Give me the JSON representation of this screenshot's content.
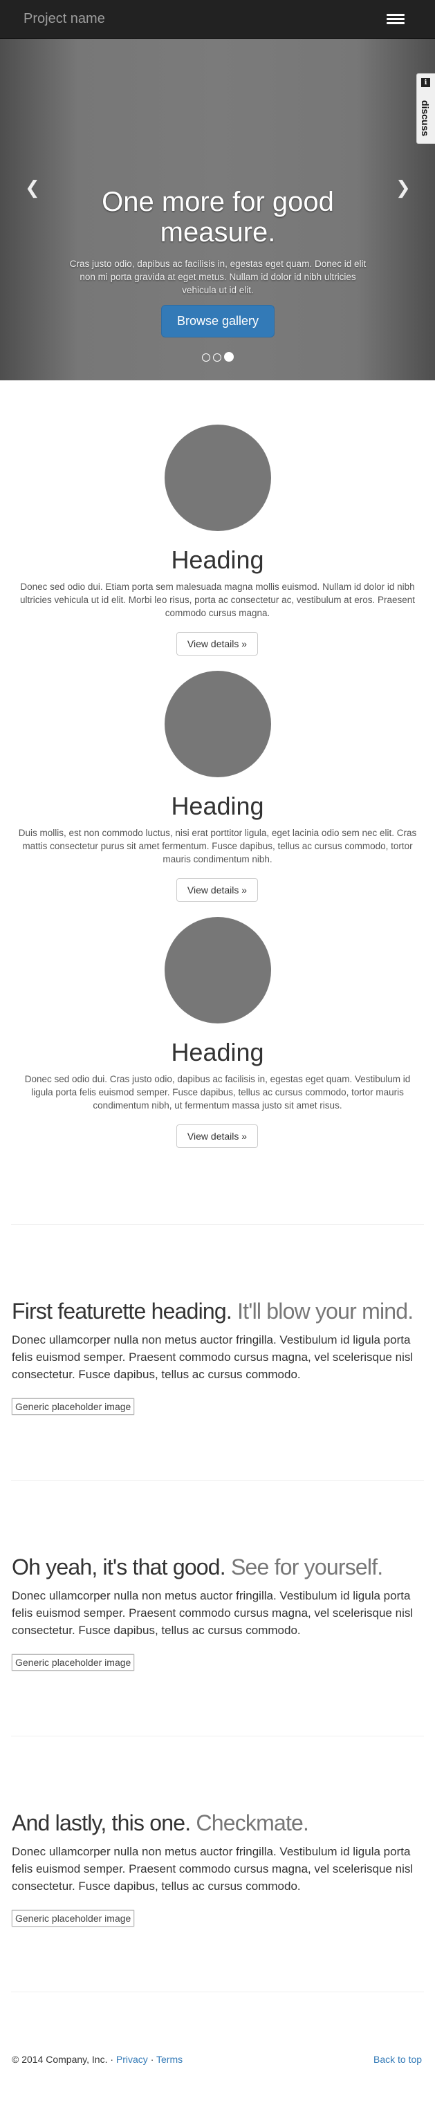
{
  "navbar": {
    "brand": "Project name",
    "toggle_icon": "hamburger-icon"
  },
  "carousel": {
    "heading": "One more for good measure.",
    "text": "Cras justo odio, dapibus ac facilisis in, egestas eget quam. Donec id elit non mi porta gravida at eget metus. Nullam id dolor id nibh ultricies vehicula ut id elit.",
    "button": "Browse gallery",
    "prev_icon": "chevron-left-icon",
    "next_icon": "chevron-right-icon",
    "slides": 3,
    "active_slide": 3
  },
  "discuss": {
    "label": "discuss",
    "icon": "i"
  },
  "columns": [
    {
      "heading": "Heading",
      "text": "Donec sed odio dui. Etiam porta sem malesuada magna mollis euismod. Nullam id dolor id nibh ultricies vehicula ut id elit. Morbi leo risus, porta ac consectetur ac, vestibulum at eros. Praesent commodo cursus magna.",
      "button": "View details »"
    },
    {
      "heading": "Heading",
      "text": "Duis mollis, est non commodo luctus, nisi erat porttitor ligula, eget lacinia odio sem nec elit. Cras mattis consectetur purus sit amet fermentum. Fusce dapibus, tellus ac cursus commodo, tortor mauris condimentum nibh.",
      "button": "View details »"
    },
    {
      "heading": "Heading",
      "text": "Donec sed odio dui. Cras justo odio, dapibus ac facilisis in, egestas eget quam. Vestibulum id ligula porta felis euismod semper. Fusce dapibus, tellus ac cursus commodo, tortor mauris condimentum nibh, ut fermentum massa justo sit amet risus.",
      "button": "View details »"
    }
  ],
  "featurettes": [
    {
      "heading": "First featurette heading.",
      "muted": "It'll blow your mind.",
      "lead": "Donec ullamcorper nulla non metus auctor fringilla. Vestibulum id ligula porta felis euismod semper. Praesent commodo cursus magna, vel scelerisque nisl consectetur. Fusce dapibus, tellus ac cursus commodo.",
      "image": "Generic placeholder image"
    },
    {
      "heading": "Oh yeah, it's that good.",
      "muted": "See for yourself.",
      "lead": "Donec ullamcorper nulla non metus auctor fringilla. Vestibulum id ligula porta felis euismod semper. Praesent commodo cursus magna, vel scelerisque nisl consectetur. Fusce dapibus, tellus ac cursus commodo.",
      "image": "Generic placeholder image"
    },
    {
      "heading": "And lastly, this one.",
      "muted": "Checkmate.",
      "lead": "Donec ullamcorper nulla non metus auctor fringilla. Vestibulum id ligula porta felis euismod semper. Praesent commodo cursus magna, vel scelerisque nisl consectetur. Fusce dapibus, tellus ac cursus commodo.",
      "image": "Generic placeholder image"
    }
  ],
  "footer": {
    "copyright": "© 2014 Company, Inc. · ",
    "privacy": "Privacy",
    "sep": " · ",
    "terms": "Terms",
    "back_to_top": "Back to top"
  }
}
